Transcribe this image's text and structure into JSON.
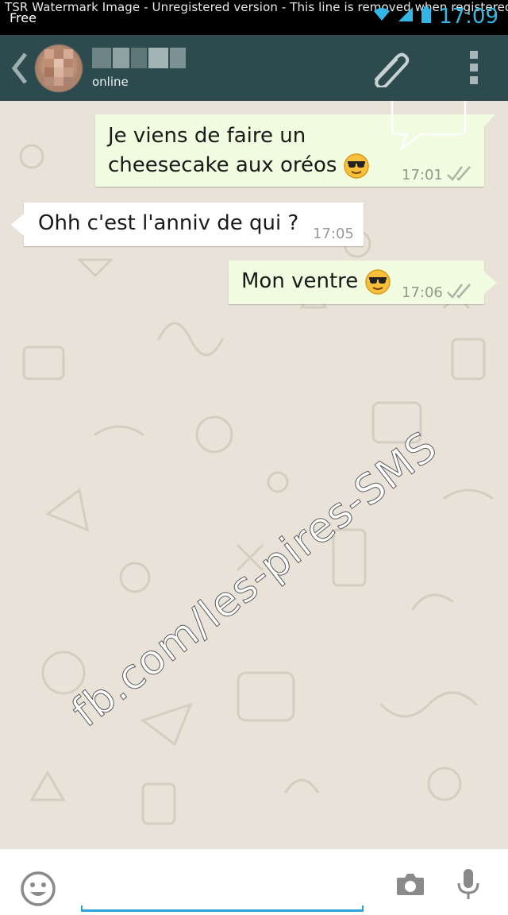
{
  "status_bar": {
    "watermark": "TSR Watermark Image - Unregistered version - This line is removed when registered",
    "carrier": "Free",
    "time": "17:09",
    "icons": [
      "wifi-icon",
      "signal-icon",
      "battery-icon"
    ],
    "clock_color": "#33b5e5"
  },
  "header": {
    "status": "online",
    "icons": [
      "back-icon",
      "attach-icon",
      "overflow-menu-icon"
    ],
    "background": "#2d4b4e"
  },
  "messages": [
    {
      "direction": "outgoing",
      "lines": [
        "Je viens de faire un",
        "cheesecake aux oréos"
      ],
      "emoji": "sunglasses-emoji",
      "time": "17:01",
      "status_icon": "double-check-icon"
    },
    {
      "direction": "incoming",
      "lines": [
        "Ohh c'est l'anniv de qui ?"
      ],
      "time": "17:05"
    },
    {
      "direction": "outgoing",
      "lines": [
        "Mon ventre"
      ],
      "emoji": "sunglasses-emoji",
      "time": "17:06",
      "status_icon": "double-check-icon"
    }
  ],
  "overlay": {
    "watermark": "fb.com/les-pires-SMS"
  },
  "input_bar": {
    "value": "",
    "icons": [
      "emoji-icon",
      "camera-icon",
      "mic-icon"
    ],
    "accent": "#2aa3d6"
  }
}
